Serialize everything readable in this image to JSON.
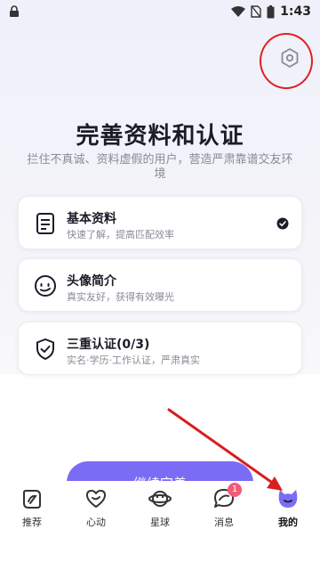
{
  "status_bar": {
    "time": "1:43",
    "icons": [
      "lock-icon",
      "wifi-icon",
      "sim-icon",
      "battery-icon"
    ]
  },
  "header": {
    "settings_icon": "settings-hexagon-icon"
  },
  "page": {
    "title": "完善资料和认证",
    "subtitle": "拦住不真诚、资料虚假的用户，营造严肃靠谱交友环境"
  },
  "cards": [
    {
      "icon": "document-icon",
      "title": "基本资料",
      "desc": "快速了解，提高匹配效率",
      "completed": true
    },
    {
      "icon": "face-icon",
      "title": "头像简介",
      "desc": "真实友好，获得有效曝光",
      "completed": false
    },
    {
      "icon": "shield-check-icon",
      "title": "三重认证(0/3)",
      "desc": "实名·学历·工作认证，严肃真实",
      "completed": false
    }
  ],
  "continue_button": {
    "label": "继续完善"
  },
  "tabs": [
    {
      "label": "推荐",
      "icon": "recommend-icon",
      "active": false
    },
    {
      "label": "心动",
      "icon": "heart-icon",
      "active": false
    },
    {
      "label": "星球",
      "icon": "planet-icon",
      "active": false
    },
    {
      "label": "消息",
      "icon": "message-icon",
      "active": false,
      "badge": "1"
    },
    {
      "label": "我的",
      "icon": "profile-cat-icon",
      "active": true
    }
  ],
  "colors": {
    "accent": "#7b6cf6",
    "badge": "#f25a7a",
    "annotation": "#e02020"
  }
}
